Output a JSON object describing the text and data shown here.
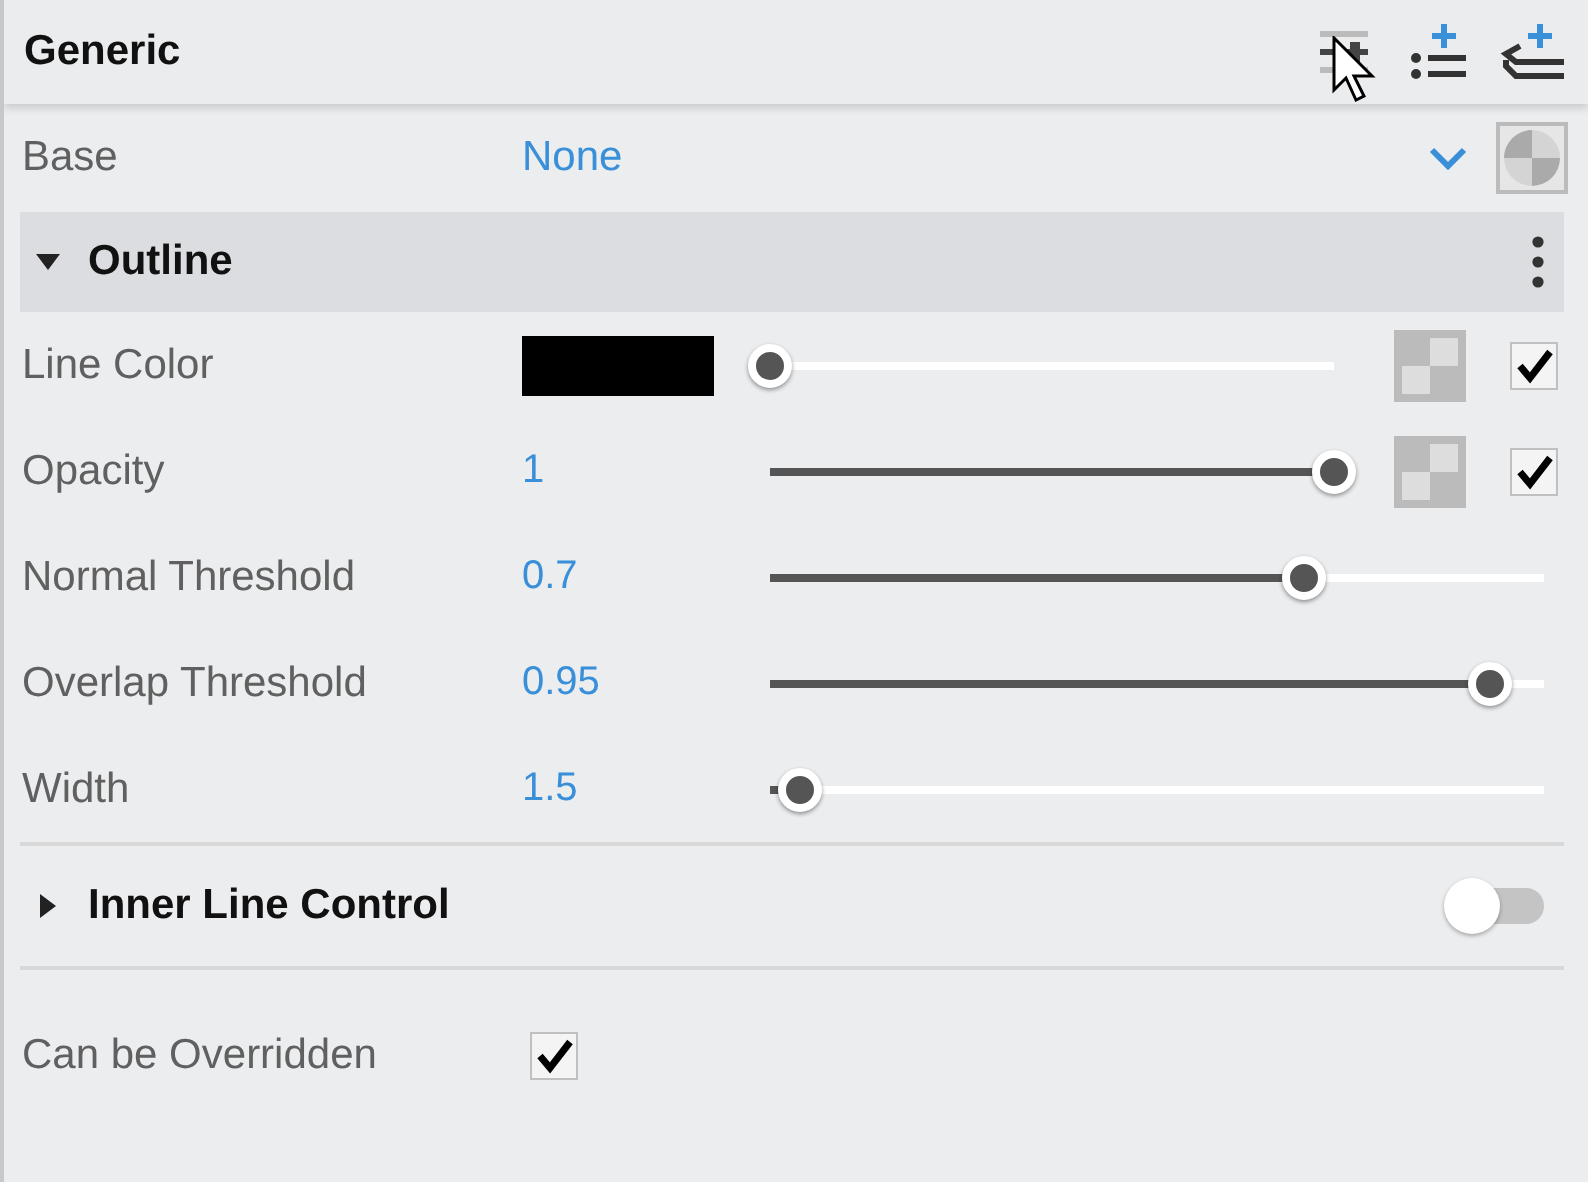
{
  "panel": {
    "title": "Generic"
  },
  "base": {
    "label": "Base",
    "value": "None"
  },
  "outline": {
    "title": "Outline",
    "expanded": true,
    "rows": [
      {
        "kind": "color",
        "label": "Line Color",
        "color": "#000000",
        "level": 0,
        "checked": true
      },
      {
        "kind": "slider",
        "label": "Opacity",
        "value": "1",
        "level": 1,
        "checked": true
      },
      {
        "kind": "slider",
        "label": "Normal Threshold",
        "value": "0.7",
        "level": 0.69
      },
      {
        "kind": "slider",
        "label": "Overlap Threshold",
        "value": "0.95",
        "level": 0.93
      },
      {
        "kind": "slider",
        "label": "Width",
        "value": "1.5",
        "level": 0.04
      }
    ]
  },
  "inner": {
    "title": "Inner Line Control",
    "expanded": false,
    "on": false
  },
  "override": {
    "label": "Can be Overridden",
    "checked": true
  }
}
